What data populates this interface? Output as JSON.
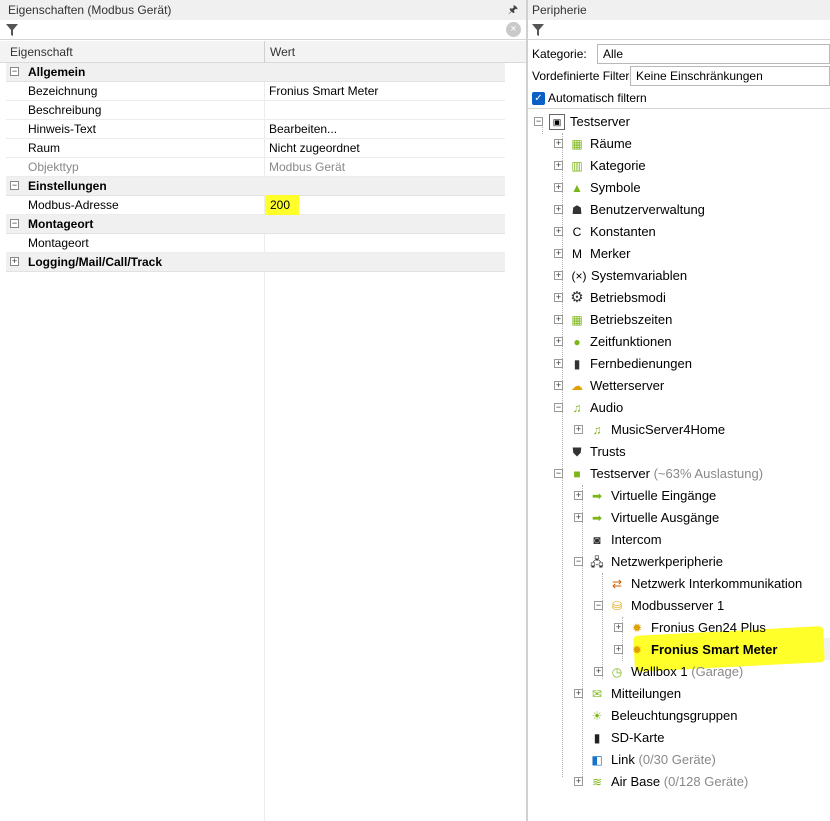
{
  "left_panel": {
    "title": "Eigenschaften (Modbus Gerät)",
    "pin_icon": "pin-icon",
    "columns": {
      "property": "Eigenschaft",
      "value": "Wert"
    },
    "categories": [
      {
        "label": "Allgemein",
        "rows": [
          {
            "key": "Bezeichnung",
            "value": "Fronius Smart Meter"
          },
          {
            "key": "Beschreibung",
            "value": ""
          },
          {
            "key": "Hinweis-Text",
            "value": "Bearbeiten..."
          },
          {
            "key": "Raum",
            "value": "Nicht zugeordnet"
          },
          {
            "key": "Objekttyp",
            "value": "Modbus Gerät"
          }
        ]
      },
      {
        "label": "Einstellungen",
        "rows": [
          {
            "key": "Modbus-Adresse",
            "value": "200"
          }
        ]
      },
      {
        "label": "Montageort",
        "rows": [
          {
            "key": "Montageort",
            "value": ""
          }
        ]
      },
      {
        "label": "Logging/Mail/Call/Track",
        "rows": []
      }
    ]
  },
  "right_panel": {
    "title": "Peripherie",
    "kategorie_label": "Kategorie:",
    "kategorie_value": "Alle",
    "filter_label": "Vordefinierte Filter",
    "filter_value": "Keine Einschränkungen",
    "auto_filter_label": "Automatisch filtern",
    "tree": {
      "root": "Testserver",
      "items": [
        "Räume",
        "Kategorie",
        "Symbole",
        "Benutzerverwaltung",
        "Konstanten",
        "Merker",
        "Systemvariablen",
        "Betriebsmodi",
        "Betriebszeiten",
        "Zeitfunktionen",
        "Fernbedienungen",
        "Wetterserver",
        "Audio",
        "MusicServer4Home",
        "Trusts",
        "Testserver",
        "(~63% Auslastung)",
        "Virtuelle Eingänge",
        "Virtuelle Ausgänge",
        "Intercom",
        "Netzwerkperipherie",
        "Netzwerk Interkommunikation",
        "Modbusserver 1",
        "Fronius Gen24 Plus",
        "Fronius Smart Meter",
        "Wallbox 1",
        "(Garage)",
        "Mitteilungen",
        "Beleuchtungsgruppen",
        "SD-Karte",
        "Link",
        "(0/30 Geräte)",
        "Air Base",
        "(0/128 Geräte)"
      ],
      "glyphs": {
        "konstanten": "C",
        "merker": "M",
        "systemvariablen": "(×)"
      }
    }
  },
  "colors": {
    "highlight": "#ffff2a",
    "checkbox": "#0a60c4",
    "green": "#7cb518"
  }
}
